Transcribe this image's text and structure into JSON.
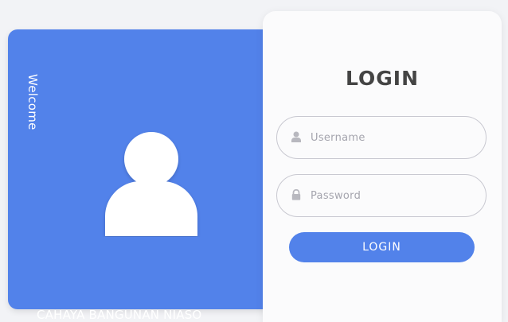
{
  "welcome": {
    "side_text": "Welcome",
    "brand_name": "CAHAYA BANGUNAN NIASO",
    "avatar_icon": "user-avatar-icon"
  },
  "login": {
    "title": "LOGIN",
    "username_placeholder": "Username",
    "username_icon": "user-icon",
    "password_placeholder": "Password",
    "password_icon": "lock-icon",
    "button_label": "LOGIN"
  },
  "colors": {
    "accent": "#5282ea",
    "card_bg": "#fbfbfc",
    "title": "#444444",
    "placeholder": "#a5a5ae",
    "field_border": "#c9c9d1"
  }
}
